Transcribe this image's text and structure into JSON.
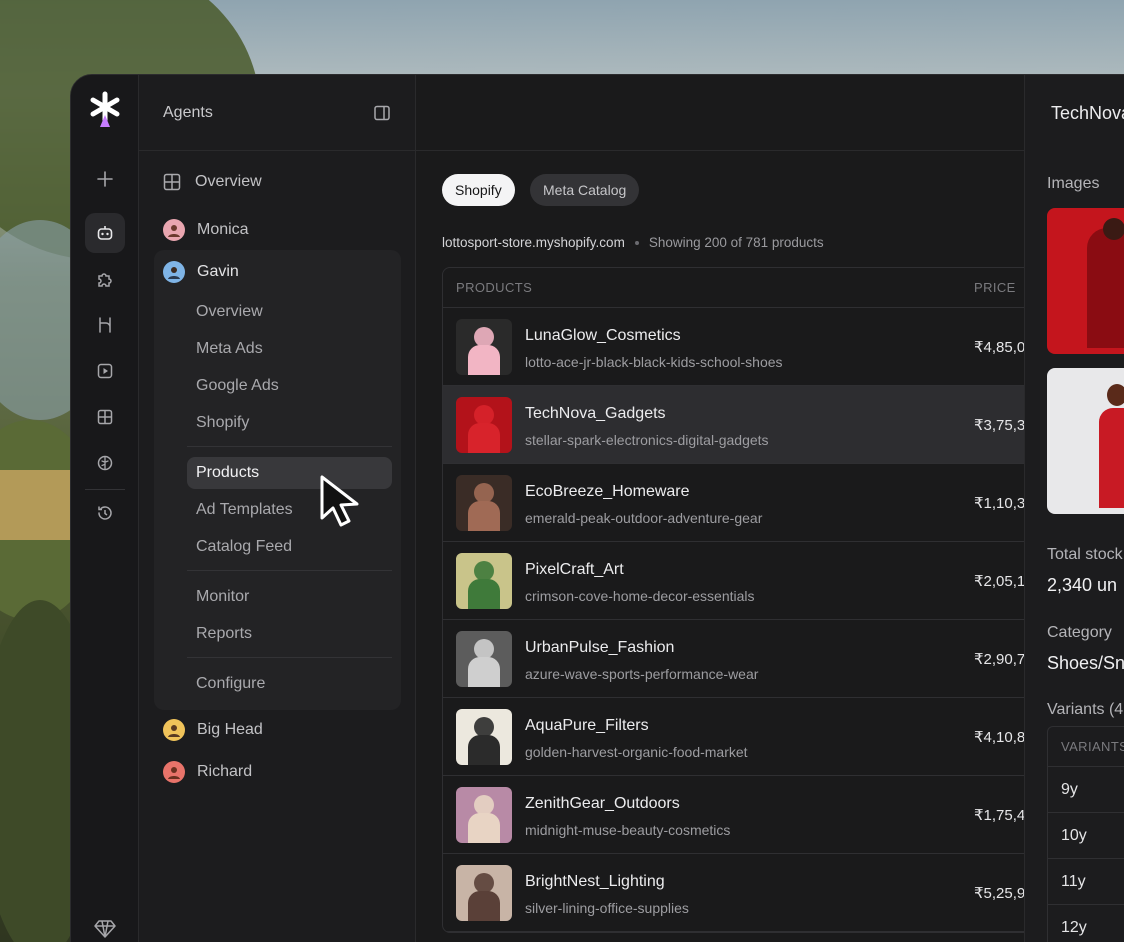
{
  "sidebar": {
    "title": "Agents",
    "agents": [
      {
        "name": "Monica",
        "avatar_color": "#e9a6b0"
      },
      {
        "name": "Gavin",
        "avatar_color": "#7fb4e6"
      },
      {
        "name": "Big Head",
        "avatar_color": "#f0c35a"
      },
      {
        "name": "Richard",
        "avatar_color": "#e8736a"
      }
    ],
    "overview_label": "Overview",
    "gavin_items": {
      "overview": "Overview",
      "meta_ads": "Meta Ads",
      "google_ads": "Google Ads",
      "shopify": "Shopify",
      "products": "Products",
      "ad_templates": "Ad Templates",
      "catalog_feed": "Catalog Feed",
      "monitor": "Monitor",
      "reports": "Reports",
      "configure": "Configure"
    }
  },
  "main": {
    "tabs": [
      "Shopify",
      "Meta Catalog"
    ],
    "store": "lottosport-store.myshopify.com",
    "count_text": "Showing 200 of 781 products",
    "columns": {
      "products": "PRODUCTS",
      "price": "PRICE"
    },
    "rows": [
      {
        "name": "LunaGlow_Cosmetics",
        "slug": "lotto-ace-jr-black-black-kids-school-shoes",
        "price": "₹4,85,0",
        "thumb_bg": "#2a2a2a",
        "thumb_fg": "#f2b5c4"
      },
      {
        "name": "TechNova_Gadgets",
        "slug": "stellar-spark-electronics-digital-gadgets",
        "price": "₹3,75,3",
        "thumb_bg": "#b3121a",
        "thumb_fg": "#d8232b"
      },
      {
        "name": "EcoBreeze_Homeware",
        "slug": "emerald-peak-outdoor-adventure-gear",
        "price": "₹1,10,3",
        "thumb_bg": "#3a2c26",
        "thumb_fg": "#a06a55"
      },
      {
        "name": "PixelCraft_Art",
        "slug": "crimson-cove-home-decor-essentials",
        "price": "₹2,05,1",
        "thumb_bg": "#c9c48a",
        "thumb_fg": "#3f7a3a"
      },
      {
        "name": "UrbanPulse_Fashion",
        "slug": "azure-wave-sports-performance-wear",
        "price": "₹2,90,7",
        "thumb_bg": "#5c5c5c",
        "thumb_fg": "#cfcfcf"
      },
      {
        "name": "AquaPure_Filters",
        "slug": "golden-harvest-organic-food-market",
        "price": "₹4,10,8",
        "thumb_bg": "#ece8de",
        "thumb_fg": "#2b2b2b"
      },
      {
        "name": "ZenithGear_Outdoors",
        "slug": "midnight-muse-beauty-cosmetics",
        "price": "₹1,75,4",
        "thumb_bg": "#b88aa6",
        "thumb_fg": "#e8d4c4"
      },
      {
        "name": "BrightNest_Lighting",
        "slug": "silver-lining-office-supplies",
        "price": "₹5,25,9",
        "thumb_bg": "#c8b4a6",
        "thumb_fg": "#5a4038"
      }
    ]
  },
  "detail": {
    "title": "TechNova",
    "images_label": "Images",
    "stock_label": "Total stock",
    "stock_value": "2,340 un",
    "category_label": "Category",
    "category_value": "Shoes/Sn",
    "variants_label": "Variants (4",
    "variants_header": "VARIANTS",
    "variants": [
      "9y",
      "10y",
      "11y",
      "12y"
    ]
  },
  "colors": {
    "accent_purple": "#c77dff",
    "selected_row": "#2d2d30"
  }
}
